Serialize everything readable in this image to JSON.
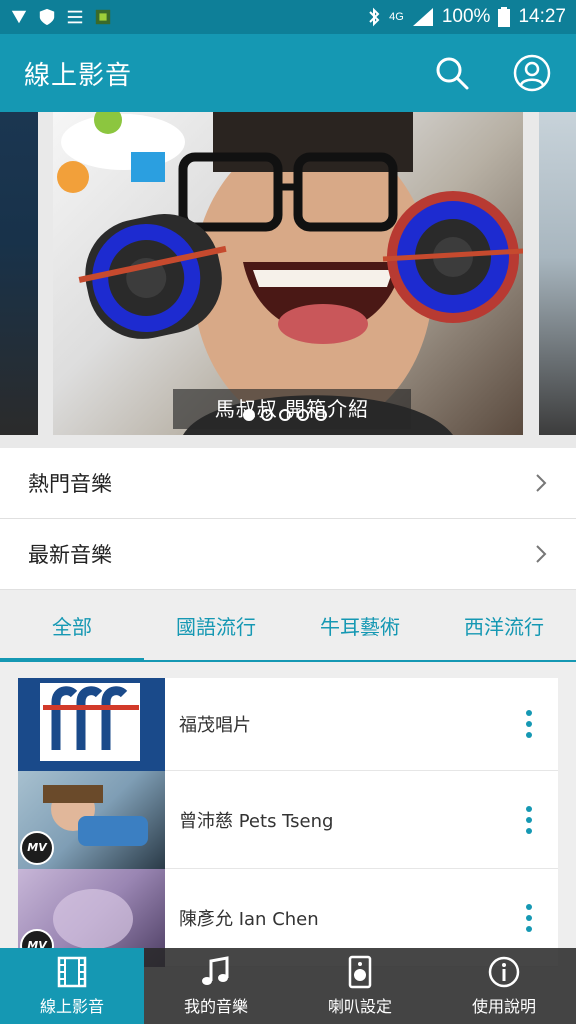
{
  "status_bar": {
    "battery": "100%",
    "time": "14:27",
    "network": "4G"
  },
  "app_bar": {
    "title": "線上影音",
    "icons": [
      "search-icon",
      "account-icon"
    ]
  },
  "carousel": {
    "caption": "馬叔叔 開箱介紹",
    "slide_count": 5,
    "active_index": 0
  },
  "menu": {
    "items": [
      {
        "label": "熱門音樂"
      },
      {
        "label": "最新音樂"
      }
    ]
  },
  "tabs": {
    "items": [
      {
        "label": "全部"
      },
      {
        "label": "國語流行"
      },
      {
        "label": "牛耳藝術"
      },
      {
        "label": "西洋流行"
      }
    ],
    "active_index": 0
  },
  "channels": {
    "items": [
      {
        "name": "福茂唱片",
        "mv": false
      },
      {
        "name": "曾沛慈 Pets Tseng",
        "mv": true
      },
      {
        "name": "陳彥允 Ian Chen",
        "mv": true
      }
    ]
  },
  "bottom_nav": {
    "items": [
      {
        "label": "線上影音",
        "icon": "film-icon"
      },
      {
        "label": "我的音樂",
        "icon": "music-note-icon"
      },
      {
        "label": "喇叭設定",
        "icon": "speaker-icon"
      },
      {
        "label": "使用說明",
        "icon": "info-icon"
      }
    ],
    "active_index": 0
  },
  "colors": {
    "primary": "#1598b3",
    "status": "#0e7f98"
  }
}
